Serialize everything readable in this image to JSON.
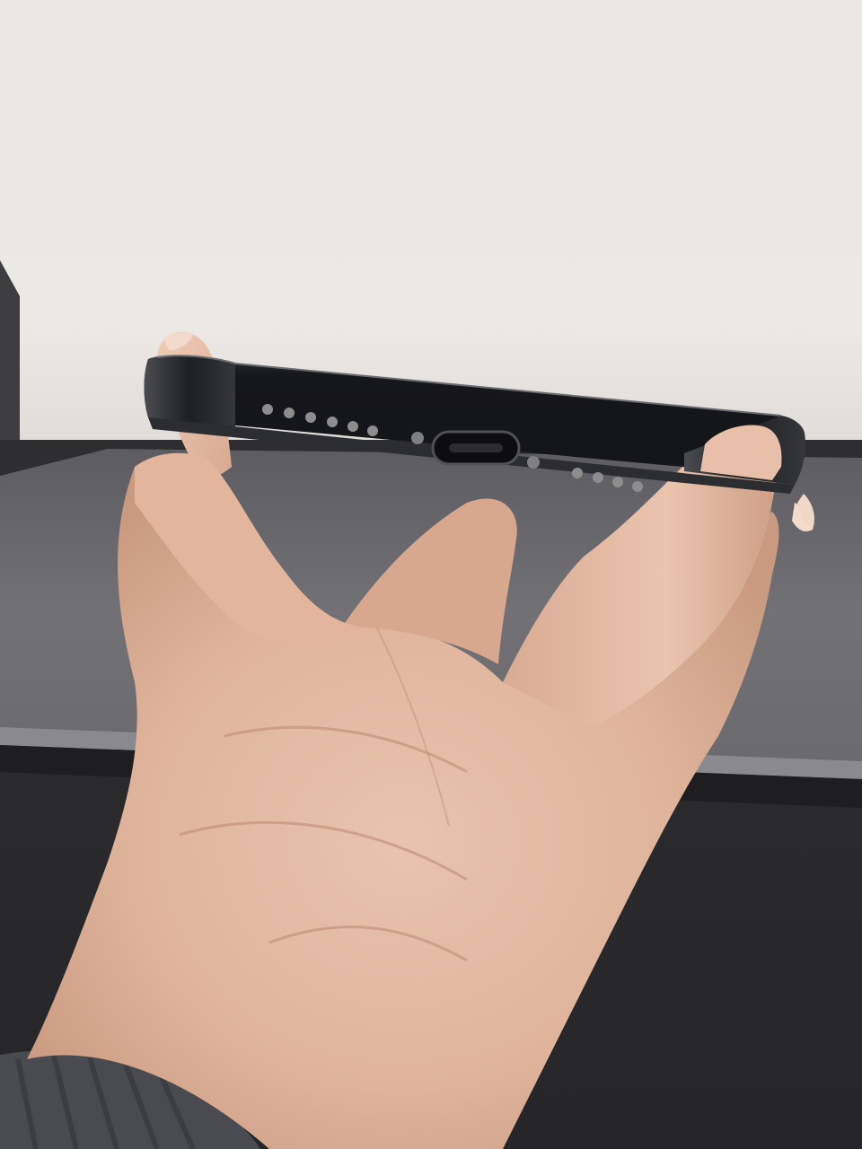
{
  "scene": {
    "subject": "smartphone-bottom-edge-held-in-hand",
    "colors": {
      "wall": "#ebe8e5",
      "wall_shadow": "#d9d6d3",
      "desk": "#2b2b2d",
      "laptop": "#6e6d70",
      "laptop_dark": "#4a494c",
      "phone_frame": "#1a1b1d",
      "phone_highlight": "#3a3c40",
      "port": "#0e0e10",
      "skin": "#e2b9a2",
      "skin_shadow": "#c89a82",
      "skin_light": "#f0cdb8",
      "sleeve": "#4a4b50"
    },
    "speaker_grille_left_holes": 6,
    "speaker_grille_right_holes": 4,
    "port_type": "usb-c"
  }
}
